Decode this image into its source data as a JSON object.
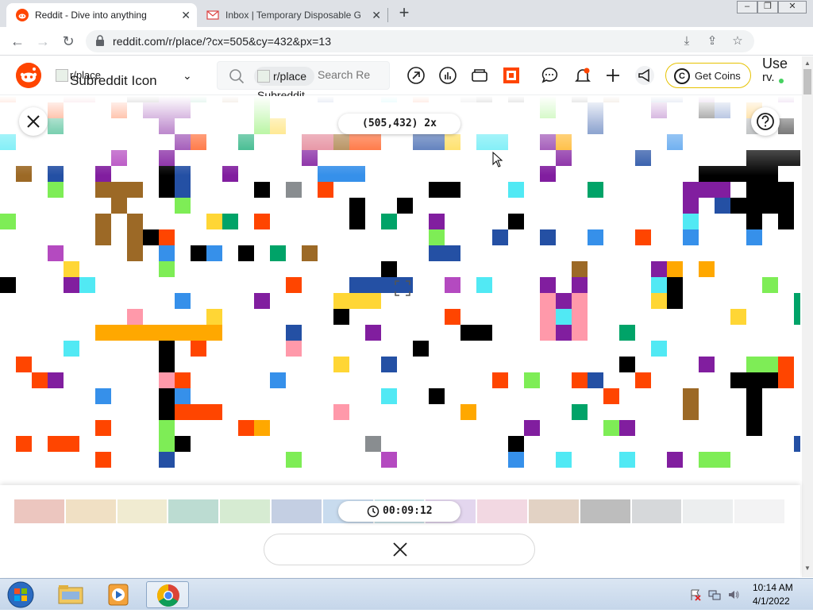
{
  "browser": {
    "tabs": [
      {
        "title": "Reddit - Dive into anything",
        "active": true,
        "favicon": "reddit-favicon"
      },
      {
        "title": "Inbox | Temporary Disposable Gm",
        "active": false,
        "favicon": "mail-favicon"
      }
    ],
    "new_tab_label": "+",
    "url": "reddit.com/r/place/?cx=505&cy=432&px=13"
  },
  "reddit": {
    "subreddit_picker": {
      "alt_small": "r/place",
      "alt_large": "Subreddit Icon"
    },
    "search": {
      "chip_label": "r/place",
      "chip_alt": "Subreddit Icon",
      "placeholder": "Search Re"
    },
    "get_coins_label": "Get Coins",
    "coins_symbol": "C",
    "user_label": "Use",
    "user_label_2": "rv."
  },
  "place": {
    "coordinates": "(505,432) 2x",
    "timer": "00:09:12",
    "palette": [
      "#ecc6bf",
      "#f0e0c4",
      "#f0ebd1",
      "#bcdcd2",
      "#d6ebd2",
      "#c4cfe3",
      "#c8dbee",
      "#cfe9ef",
      "#e3d6ee",
      "#f2d8e2",
      "#e2d2c4",
      "#bdbdbd",
      "#d6d8da",
      "#eceeef",
      "#f3f3f4"
    ],
    "colors": {
      "K": "#000000",
      "B": "#2450a4",
      "L": "#3690ea",
      "C": "#51e9f4",
      "G": "#00a368",
      "g": "#7eed56",
      "Y": "#ffd635",
      "O": "#ffa800",
      "R": "#ff4500",
      "r": "#be0039",
      "P": "#811e9f",
      "p": "#b44ac0",
      "N": "#9c6926",
      "n": "#6d482f",
      "k": "#ff99aa",
      "D": "#de6e83",
      "A": "#898d90",
      "W": "#ffffff"
    }
  },
  "taskbar": {
    "time": "10:14 AM",
    "date": "4/1/2022"
  }
}
